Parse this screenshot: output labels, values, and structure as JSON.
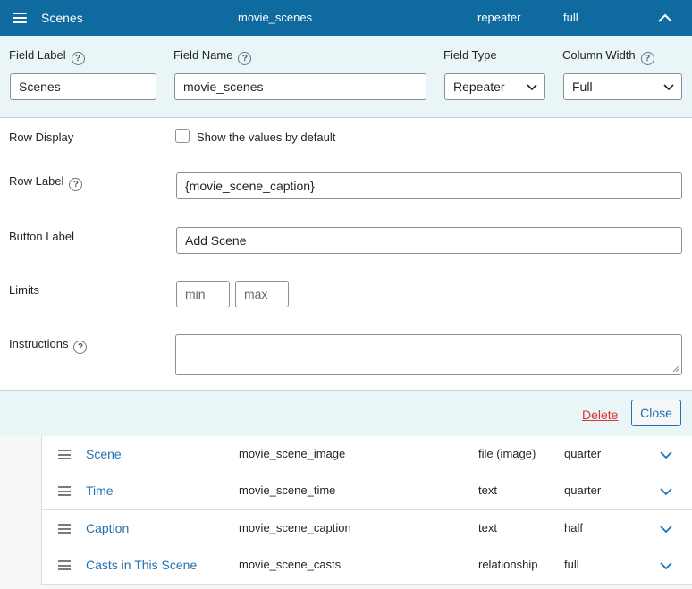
{
  "header": {
    "title": "Scenes",
    "field_name": "movie_scenes",
    "field_type": "repeater",
    "width": "full"
  },
  "settings": {
    "field_label": {
      "label": "Field Label",
      "value": "Scenes"
    },
    "field_name": {
      "label": "Field Name",
      "value": "movie_scenes"
    },
    "field_type": {
      "label": "Field Type",
      "value": "Repeater"
    },
    "column_width": {
      "label": "Column Width",
      "value": "Full"
    },
    "row_display": {
      "label": "Row Display",
      "checkbox_label": "Show the values by default",
      "checked": false
    },
    "row_label": {
      "label": "Row Label",
      "value": "{movie_scene_caption}"
    },
    "button_label": {
      "label": "Button Label",
      "value": "Add Scene"
    },
    "limits": {
      "label": "Limits",
      "min_placeholder": "min",
      "max_placeholder": "max"
    },
    "instructions": {
      "label": "Instructions",
      "value": ""
    },
    "help_glyph": "?"
  },
  "actions": {
    "delete": "Delete",
    "close": "Close"
  },
  "subfields": [
    {
      "label": "Scene",
      "name": "movie_scene_image",
      "type": "file (image)",
      "width": "quarter"
    },
    {
      "label": "Time",
      "name": "movie_scene_time",
      "type": "text",
      "width": "quarter"
    },
    {
      "label": "Caption",
      "name": "movie_scene_caption",
      "type": "text",
      "width": "half"
    },
    {
      "label": "Casts in This Scene",
      "name": "movie_scene_casts",
      "type": "relationship",
      "width": "full"
    }
  ],
  "colors": {
    "header_bg": "#0f6aa0",
    "panel_bg": "#eaf5f8",
    "link": "#2271b1",
    "danger": "#d63638"
  }
}
